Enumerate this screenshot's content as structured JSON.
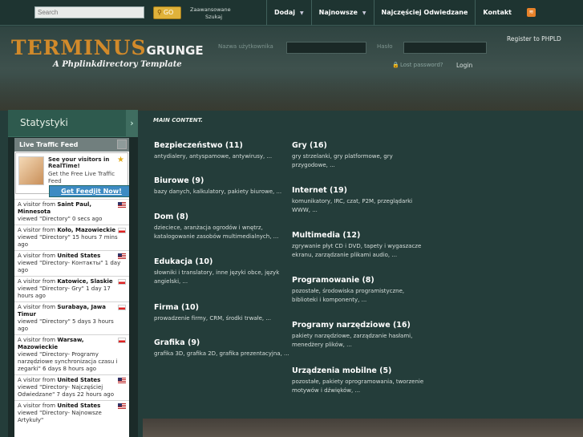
{
  "topbar": {
    "search_placeholder": "Search",
    "go_label": "GO",
    "advanced_line1": "Zaawansowane",
    "advanced_line2": "Szukaj",
    "nav": [
      {
        "label": "Dodaj",
        "dropdown": true
      },
      {
        "label": "Najnowsze",
        "dropdown": true
      },
      {
        "label": "Najczęściej Odwiedzane",
        "dropdown": false
      },
      {
        "label": "Kontakt",
        "dropdown": false
      }
    ],
    "rss_icon": "rss-icon"
  },
  "header": {
    "logo_main": "TERMINUS",
    "logo_sub": "GRUNGE",
    "tagline": "A Phplinkdirectory Template",
    "username_label": "Nazwa użytkownika",
    "password_label": "Hasło",
    "register_link": "Register to PHPLD",
    "lost_password": "Lost password?",
    "login_link": "Login"
  },
  "sidebar": {
    "title": "Statystyki",
    "feed_title": "Live Traffic Feed",
    "promo_title": "See your visitors in RealTime!",
    "promo_sub": "Get the Free Live Traffic Feed",
    "get_button": "Get Feedjit Now!",
    "entries": [
      {
        "pre": "A visitor from",
        "place": "Saint Paul, Minnesota",
        "text": "viewed \"Directory\" 0 secs ago",
        "flag": "us"
      },
      {
        "pre": "A visitor from",
        "place": "Koło, Mazowieckie",
        "text": "viewed \"Directory\" 15 hours 7 mins ago",
        "flag": "pl"
      },
      {
        "pre": "A visitor from",
        "place": "United States",
        "text": "viewed \"Directory- Контакты\" 1 day ago",
        "flag": "us"
      },
      {
        "pre": "A visitor from",
        "place": "Katowice, Slaskie",
        "text": "viewed \"Directory- Gry\" 1 day 17 hours ago",
        "flag": "pl"
      },
      {
        "pre": "A visitor from",
        "place": "Surabaya, Jawa Timur",
        "text": "viewed \"Directory\" 5 days 3 hours ago",
        "flag": "pl"
      },
      {
        "pre": "A visitor from",
        "place": "Warsaw, Mazowieckie",
        "text": "viewed \"Directory- Programy narzędziowe synchronizacja czasu i zegarki\" 6 days 8 hours ago",
        "flag": "pl"
      },
      {
        "pre": "A visitor from",
        "place": "United States",
        "text": "viewed \"Directory- Najczęściej Odwiedzane\" 7 days 22 hours ago",
        "flag": "us"
      },
      {
        "pre": "A visitor from",
        "place": "United States",
        "text": "viewed \"Directory- Najnowsze Artykuły\"",
        "flag": "us"
      }
    ]
  },
  "main": {
    "heading": "MAIN CONTENT.",
    "col1": [
      {
        "title": "Bezpieczeństwo (11)",
        "sub": "antydialery, antyspamowe, antywirusy, ..."
      },
      {
        "title": "Biurowe (9)",
        "sub": "bazy danych, kalkulatory, pakiety biurowe, ..."
      },
      {
        "title": "Dom (8)",
        "sub": "dzieciece, aranżacja ogrodów i wnętrz, katalogowanie zasobów multimedialnych, ..."
      },
      {
        "title": "Edukacja (10)",
        "sub": "słowniki i translatory, inne języki obce, język angielski, ..."
      },
      {
        "title": "Firma (10)",
        "sub": "prowadzenie firmy, CRM, środki trwałe, ..."
      },
      {
        "title": "Grafika (9)",
        "sub": "grafika 3D, grafika 2D, grafika prezentacyjna, ..."
      }
    ],
    "col2": [
      {
        "title": "Gry (16)",
        "sub": "gry strzelanki, gry platformowe, gry przygodowe, ..."
      },
      {
        "title": "Internet (19)",
        "sub": "komunikatory, IRC, czat, P2M, przeglądarki WWW, ..."
      },
      {
        "title": "Multimedia (12)",
        "sub": "zgrywanie płyt CD i DVD, tapety i wygaszacze ekranu, zarządzanie plikami audio, ..."
      },
      {
        "title": "Programowanie (8)",
        "sub": "pozostałe, środowiska programistyczne, biblioteki i komponenty, ..."
      },
      {
        "title": "Programy narzędziowe (16)",
        "sub": "pakiety narzędziowe, zarządzanie hasłami, menedżery plików, ..."
      },
      {
        "title": "Urządzenia mobilne (5)",
        "sub": "pozostałe, pakiety oprogramowania, tworzenie motywów i dźwięków, ..."
      }
    ]
  }
}
